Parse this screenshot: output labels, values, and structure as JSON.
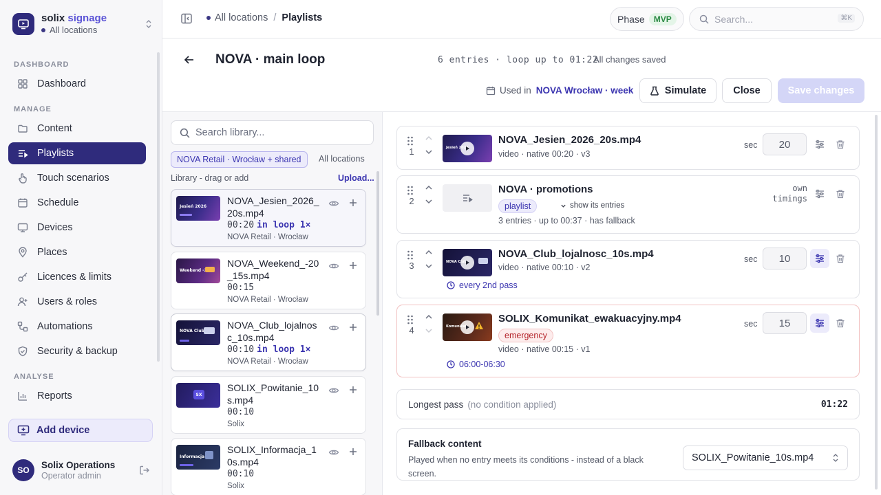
{
  "brand": {
    "name": "solix",
    "name_accent": "signage",
    "location": "All locations"
  },
  "nav": {
    "sections": {
      "dashboard": "DASHBOARD",
      "manage": "MANAGE",
      "analyse": "ANALYSE"
    },
    "items": {
      "dashboard": "Dashboard",
      "content": "Content",
      "playlists": "Playlists",
      "touch": "Touch scenarios",
      "schedule": "Schedule",
      "devices": "Devices",
      "places": "Places",
      "licences": "Licences & limits",
      "users": "Users & roles",
      "automations": "Automations",
      "security": "Security & backup",
      "reports": "Reports"
    },
    "add_device": "Add device"
  },
  "user": {
    "initials": "SO",
    "name": "Solix Operations",
    "role": "Operator admin"
  },
  "topbar": {
    "crumb_root": "All locations",
    "crumb_sep": "/",
    "crumb_current": "Playlists",
    "phase_label": "Phase",
    "phase_value": "MVP",
    "search_placeholder": "Search...",
    "search_kbd": "⌘K"
  },
  "header": {
    "title": "NOVA · main loop",
    "entries_info": "6 entries · loop up to 01:22",
    "saved_info": "All changes saved",
    "used_in_label": "Used in",
    "used_in_link": "NOVA Wrocław · week",
    "simulate": "Simulate",
    "close": "Close",
    "save": "Save changes"
  },
  "library": {
    "search_placeholder": "Search library...",
    "filter_active": "NOVA Retail · Wrocław + shared",
    "filter_all": "All locations",
    "hint": "Library - drag or add",
    "upload": "Upload...",
    "items": [
      {
        "name": "NOVA_Jesien_2026_20s.mp4",
        "dur": "00:20",
        "in_loop": "in loop 1×",
        "src": "NOVA Retail · Wrocław",
        "thumb": "Jesień 2026"
      },
      {
        "name": "NOVA_Weekend_-20_15s.mp4",
        "dur": "00:15",
        "in_loop": "",
        "src": "NOVA Retail · Wrocław",
        "thumb": "Weekend -20%"
      },
      {
        "name": "NOVA_Club_lojalnosc_10s.mp4",
        "dur": "00:10",
        "in_loop": "in loop 1×",
        "src": "NOVA Retail · Wrocław",
        "thumb": "NOVA Club"
      },
      {
        "name": "SOLIX_Powitanie_10s.mp4",
        "dur": "00:10",
        "in_loop": "",
        "src": "Solix",
        "thumb": "SX"
      },
      {
        "name": "SOLIX_Informacja_10s.mp4",
        "dur": "00:10",
        "in_loop": "",
        "src": "Solix",
        "thumb": "Informacja"
      }
    ]
  },
  "entries": [
    {
      "index": "1",
      "name": "NOVA_Jesien_2026_20s.mp4",
      "meta": "video · native 00:20 · v3",
      "sec_label": "sec",
      "sec": "20",
      "thumb": "Jesień 2026"
    },
    {
      "index": "2",
      "name": "NOVA · promotions",
      "tag": "playlist",
      "show_entries": "show its entries",
      "meta": "3 entries · up to 00:37 · has fallback",
      "own_timings": "own timings"
    },
    {
      "index": "3",
      "name": "NOVA_Club_lojalnosc_10s.mp4",
      "meta": "video · native 00:10 · v2",
      "sec_label": "sec",
      "sec": "10",
      "condition": "every 2nd pass",
      "thumb": "NOVA Club"
    },
    {
      "index": "4",
      "name": "SOLIX_Komunikat_ewakuacyjny.mp4",
      "tag": "emergency",
      "meta": "video · native 00:15 · v1",
      "sec_label": "sec",
      "sec": "15",
      "condition": "06:00-06:30",
      "thumb": "Komunikat"
    }
  ],
  "summary": {
    "label": "Longest pass",
    "note": "(no condition applied)",
    "value": "01:22"
  },
  "fallback": {
    "title": "Fallback content",
    "desc": "Played when no entry meets its conditions - instead of a black screen.",
    "selected": "SOLIX_Powitanie_10s.mp4"
  },
  "colors": {
    "brand": "#2f2b7c",
    "accent": "#3b35b0",
    "emergency": "#b4232a"
  }
}
